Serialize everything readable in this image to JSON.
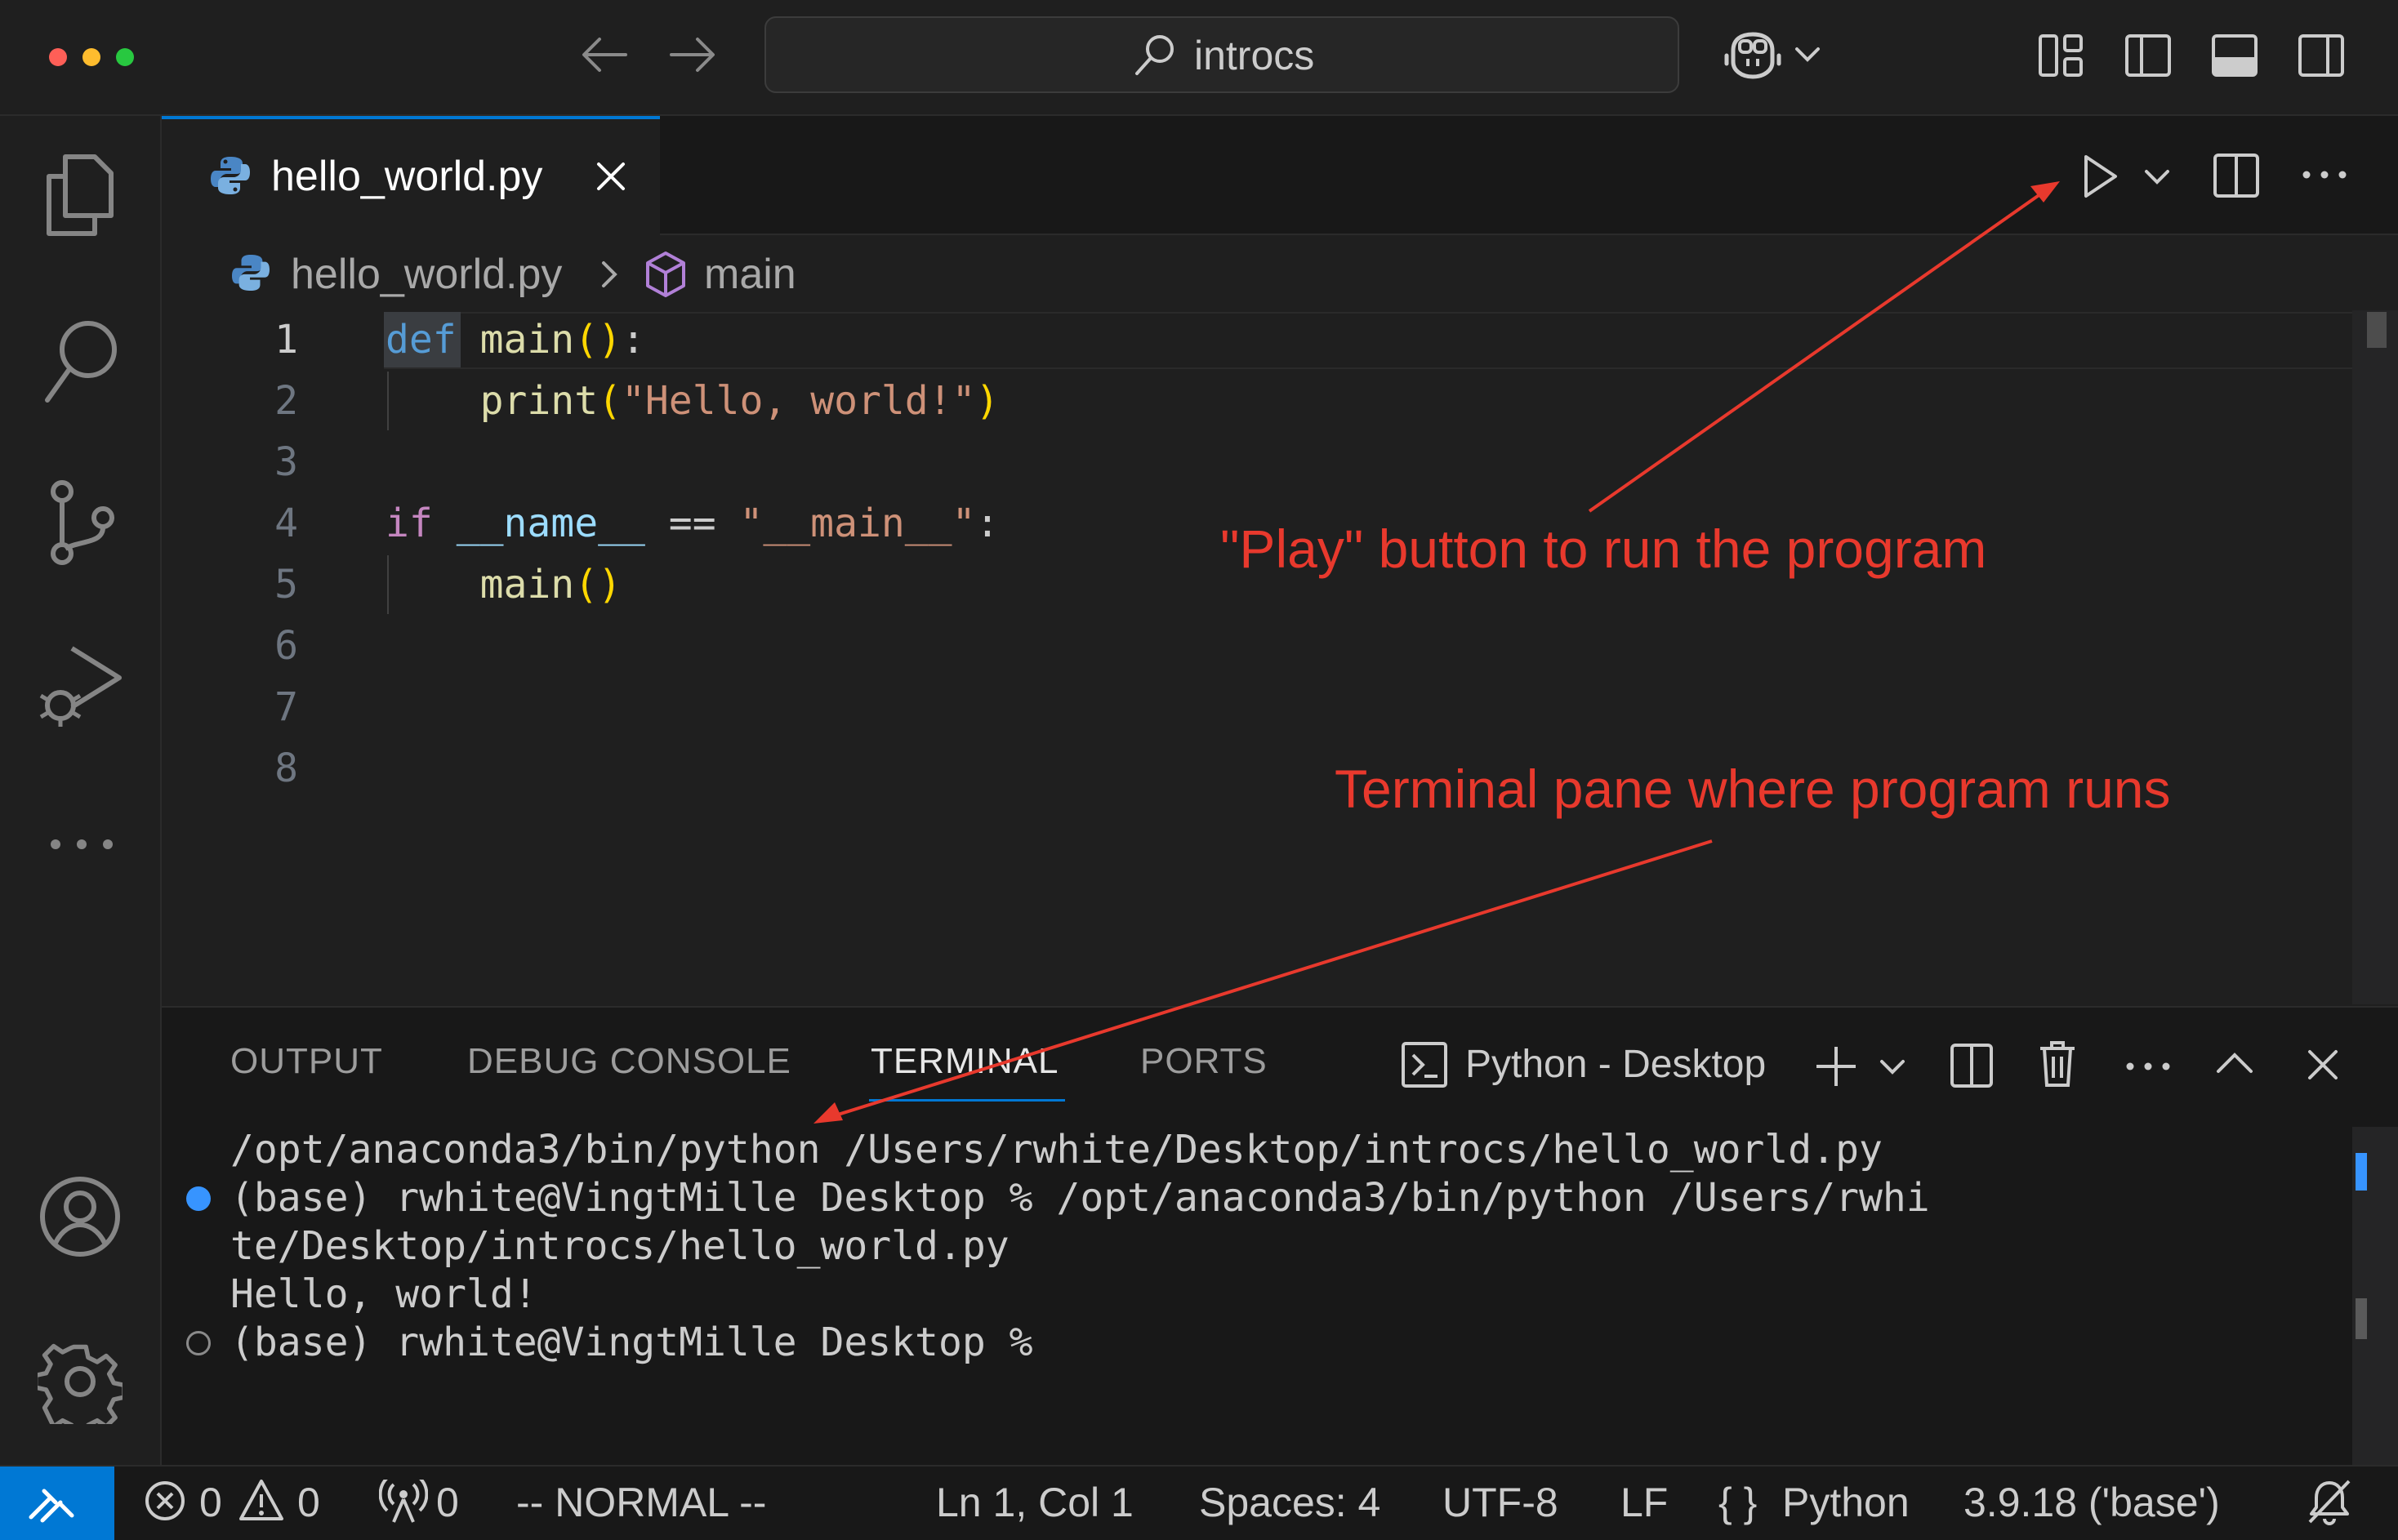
{
  "colors": {
    "accent": "#0078d4",
    "annotation": "#e8392d",
    "traffic_close": "#fe5f57",
    "traffic_minimize": "#febc2e",
    "traffic_zoom": "#28c840"
  },
  "titlebar": {
    "search_text": "introcs"
  },
  "tab": {
    "filename": "hello_world.py"
  },
  "breadcrumb": {
    "file": "hello_world.py",
    "symbol": "main"
  },
  "editor": {
    "line_numbers": [
      "1",
      "2",
      "3",
      "4",
      "5",
      "6",
      "7",
      "8"
    ],
    "lines": [
      "def main():",
      "    print(\"Hello, world!\")",
      "",
      "if __name__ == \"__main__\":",
      "    main()",
      "",
      "",
      ""
    ],
    "tokens": {
      "l1_def": "def",
      "l1_name": " main",
      "l1_parens": "()",
      "l1_colon": ":",
      "l2_indent": "    ",
      "l2_print": "print",
      "l2_open": "(",
      "l2_str": "\"Hello, world!\"",
      "l2_close": ")",
      "l4_if": "if",
      "l4_sp": " ",
      "l4_name": "__name__",
      "l4_eq": " == ",
      "l4_str": "\"__main__\"",
      "l4_colon": ":",
      "l5_indent": "    ",
      "l5_main": "main",
      "l5_parens": "()"
    }
  },
  "panel": {
    "tabs": [
      "OUTPUT",
      "DEBUG CONSOLE",
      "TERMINAL",
      "PORTS"
    ],
    "active_tab": "TERMINAL",
    "shell_label": "Python - Desktop",
    "terminal_lines": [
      "/opt/anaconda3/bin/python /Users/rwhite/Desktop/introcs/hello_world.py",
      "(base) rwhite@VingtMille Desktop % /opt/anaconda3/bin/python /Users/rwhi",
      "te/Desktop/introcs/hello_world.py",
      "Hello, world!",
      "(base) rwhite@VingtMille Desktop %"
    ]
  },
  "statusbar": {
    "errors": "0",
    "warnings": "0",
    "ports": "0",
    "mode": "-- NORMAL --",
    "position": "Ln 1, Col 1",
    "spaces": "Spaces: 4",
    "encoding": "UTF-8",
    "eol": "LF",
    "language_braces": "{ }",
    "language": "Python",
    "interpreter": "3.9.18 ('base')"
  },
  "annotations": {
    "play": "\"Play\" button to run the program",
    "terminal": "Terminal pane where program runs"
  }
}
